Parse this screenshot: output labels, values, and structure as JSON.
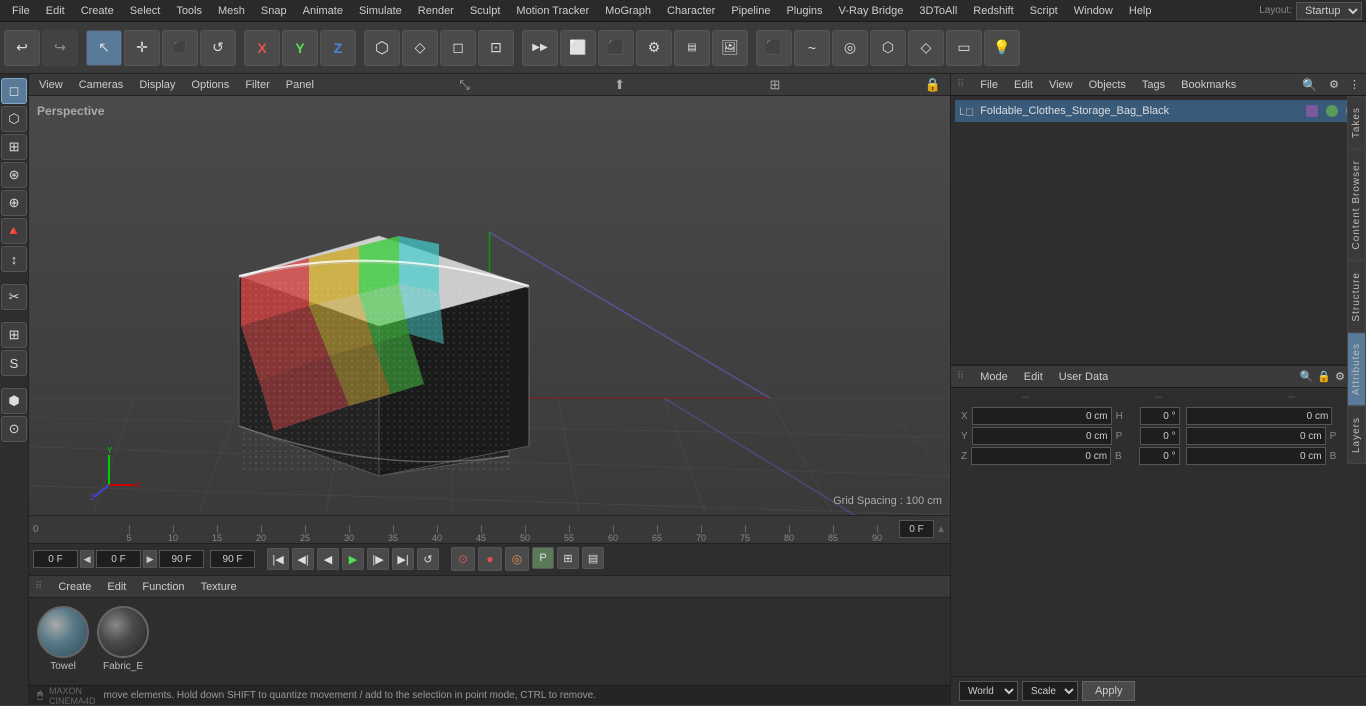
{
  "app": {
    "title": "Cinema 4D"
  },
  "menu": {
    "items": [
      "File",
      "Edit",
      "Create",
      "Select",
      "Tools",
      "Mesh",
      "Snap",
      "Animate",
      "Simulate",
      "Render",
      "Sculpt",
      "Motion Tracker",
      "MoGraph",
      "Character",
      "Pipeline",
      "Plugins",
      "V-Ray Bridge",
      "3DToAll",
      "Redshift",
      "Script",
      "Window",
      "Help"
    ],
    "layout_label": "Layout:",
    "layout_value": "Startup"
  },
  "toolbar": {
    "undo_icon": "↩",
    "redo_icon": "↪",
    "cursor_icon": "↖",
    "move_icon": "✛",
    "scale_icon": "⬛",
    "rotate_icon": "↺",
    "x_axis": "X",
    "y_axis": "Y",
    "z_axis": "Z",
    "render_icon": "▶",
    "camera_icon": "📷"
  },
  "viewport": {
    "header_items": [
      "View",
      "Cameras",
      "Display",
      "Options",
      "Filter",
      "Panel"
    ],
    "perspective_label": "Perspective",
    "grid_spacing_label": "Grid Spacing : 100 cm"
  },
  "timeline": {
    "ruler_marks": [
      "0",
      "5",
      "10",
      "15",
      "20",
      "25",
      "30",
      "35",
      "40",
      "45",
      "50",
      "55",
      "60",
      "65",
      "70",
      "75",
      "80",
      "85",
      "90"
    ],
    "current_frame": "0 F",
    "start_frame": "0 F",
    "end_frame": "90 F",
    "end_frame2": "90 F",
    "frame_label": "0F"
  },
  "object_manager": {
    "header_items": [
      "File",
      "Edit",
      "View",
      "Objects",
      "Tags",
      "Bookmarks"
    ],
    "objects": [
      {
        "name": "Foldable_Clothes_Storage_Bag_Black",
        "has_purple_dot": true,
        "has_green_dot": true
      }
    ]
  },
  "attributes": {
    "header_items": [
      "Mode",
      "Edit",
      "User Data"
    ],
    "coord_headers": [
      "--",
      "--",
      "--"
    ],
    "coords": [
      {
        "label": "X",
        "pos": "0 cm",
        "pos2": "0 cm",
        "rot": "0 °",
        "size": "0 °"
      },
      {
        "label": "Y",
        "pos": "0 cm",
        "pos2": "0 cm",
        "rot": "0 °",
        "size": "P"
      },
      {
        "label": "Z",
        "pos": "0 cm",
        "pos2": "0 cm",
        "rot": "0 °",
        "size": "0 °"
      }
    ],
    "col1_hdr": "H",
    "col2_hdr": "P",
    "col3_hdr": "B",
    "world_label": "World",
    "scale_label": "Scale",
    "apply_label": "Apply",
    "position_rows": [
      {
        "axis": "X",
        "val1": "0 cm",
        "val2": "0 cm",
        "val3": "H",
        "ang": "0 °"
      },
      {
        "axis": "Y",
        "val1": "0 cm",
        "val2": "0 cm",
        "val3": "P",
        "ang": "0 °"
      },
      {
        "axis": "Z",
        "val1": "0 cm",
        "val2": "0 cm",
        "val3": "B",
        "ang": "0 °"
      }
    ]
  },
  "materials": {
    "header_items": [
      "Create",
      "Edit",
      "Function",
      "Texture"
    ],
    "items": [
      {
        "name": "Towel"
      },
      {
        "name": "Fabric_E"
      }
    ]
  },
  "status_bar": {
    "message": "move elements. Hold down SHIFT to quantize movement / add to the selection in point mode, CTRL to remove."
  },
  "right_tabs": {
    "tabs": [
      "Takes",
      "Content Browser",
      "Structure",
      "Attributes",
      "Layers"
    ]
  }
}
